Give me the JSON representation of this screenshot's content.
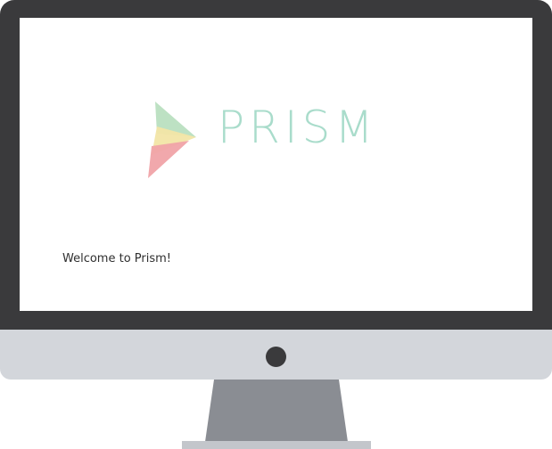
{
  "app": {
    "brand_name": "PRISM",
    "logo_icon": "prism-logo-icon",
    "welcome_text": "Welcome to Prism!"
  },
  "device": {
    "bezel_color": "#3a3a3c",
    "chin_color": "#d3d6db",
    "stand_color": "#8a8d93"
  },
  "colors": {
    "logo_green": "#b9dfc0",
    "logo_yellow": "#f2e5a6",
    "logo_pink": "#f0a3a8",
    "wordmark": "#a9dccb"
  }
}
